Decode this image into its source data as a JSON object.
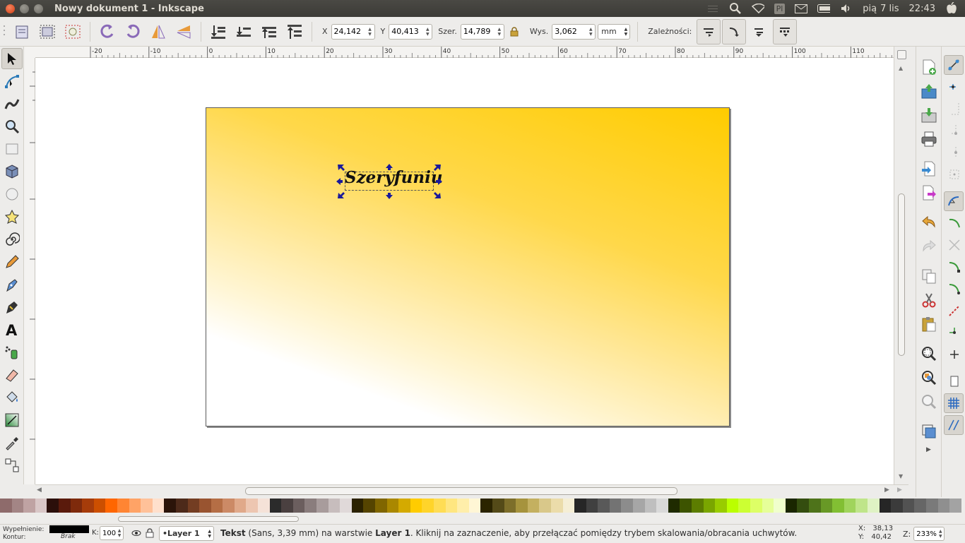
{
  "window": {
    "title": "Nowy dokument 1 - Inkscape"
  },
  "tray": {
    "keyboard": "Pl",
    "datetime_day": "pią",
    "datetime_date": "7 lis",
    "datetime_time": "22:43"
  },
  "toolbar": {
    "x_label": "X",
    "x_value": "24,142",
    "y_label": "Y",
    "y_value": "40,413",
    "w_label": "Szer.",
    "w_value": "14,789",
    "h_label": "Wys.",
    "h_value": "3,062",
    "unit": "mm",
    "dependencies_label": "Zależności:"
  },
  "ruler": {
    "h_ticks": [
      "-20",
      "-10",
      "0",
      "10",
      "20",
      "30",
      "40",
      "50",
      "60",
      "70",
      "80",
      "90",
      "100",
      "110"
    ]
  },
  "canvas": {
    "text_object": "Szeryfuniu",
    "gradient_colors": [
      "#ffcc00",
      "#ffffff"
    ]
  },
  "palette": {
    "colors": [
      "#8e6b6b",
      "#a38585",
      "#bfa3a3",
      "#d9c7c7",
      "#2b0f0a",
      "#5a1a0c",
      "#7e2a0c",
      "#a63c0a",
      "#cc4f00",
      "#ff6600",
      "#ff8533",
      "#ffa366",
      "#ffc199",
      "#ffe0cc",
      "#2b1409",
      "#4d2a1a",
      "#733d22",
      "#995430",
      "#b56e45",
      "#cc8a66",
      "#e0a98a",
      "#edc6b1",
      "#f5e2d8",
      "#2b2b2b",
      "#4a4040",
      "#6b5e5e",
      "#8a7d7d",
      "#a89c9c",
      "#c7bdbd",
      "#e0d9d9",
      "#2b2200",
      "#554400",
      "#806600",
      "#aa8800",
      "#d4aa00",
      "#ffcc00",
      "#ffd42a",
      "#ffdd55",
      "#ffe680",
      "#ffeeaa",
      "#fff6d5",
      "#2b2400",
      "#544a18",
      "#7d6e2a",
      "#a6933d",
      "#c4b060",
      "#d9c88a",
      "#ebdcaa",
      "#f5eed5",
      "#262626",
      "#404040",
      "#595959",
      "#737373",
      "#8c8c8c",
      "#a6a6a6",
      "#bfbfbf",
      "#d9d9d9",
      "#1f2b00",
      "#3d5400",
      "#5c7d00",
      "#7aa600",
      "#99cc00",
      "#bbff00",
      "#ccff33",
      "#ddff66",
      "#e6ff99",
      "#f0ffcc",
      "#1a2600",
      "#344d0f",
      "#4e731a",
      "#689926",
      "#82bf33",
      "#a0d45c",
      "#bfe58a",
      "#dff2c4",
      "#262626",
      "#3b3b3b",
      "#525252",
      "#666666",
      "#7a7a7a",
      "#8f8f8f",
      "#a3a3a3"
    ]
  },
  "status": {
    "fill_label": "Wypełnienie:",
    "stroke_label": "Kontur:",
    "stroke_value": "Brak",
    "k_label": "K:",
    "k_value": "100",
    "layer_value": "•Layer 1",
    "msg_bold": "Tekst",
    "msg_part1": " (Sans, 3,39 mm) na warstwie ",
    "msg_layer": "Layer 1",
    "msg_part2": ". Kliknij na zaznaczenie, aby przełączać pomiędzy trybem skalowania/obracania uchwytów.",
    "coord_x_label": "X:",
    "coord_x": "38,13",
    "coord_y_label": "Y:",
    "coord_y": "40,42",
    "zoom_label": "Z:",
    "zoom_value": "233%"
  }
}
